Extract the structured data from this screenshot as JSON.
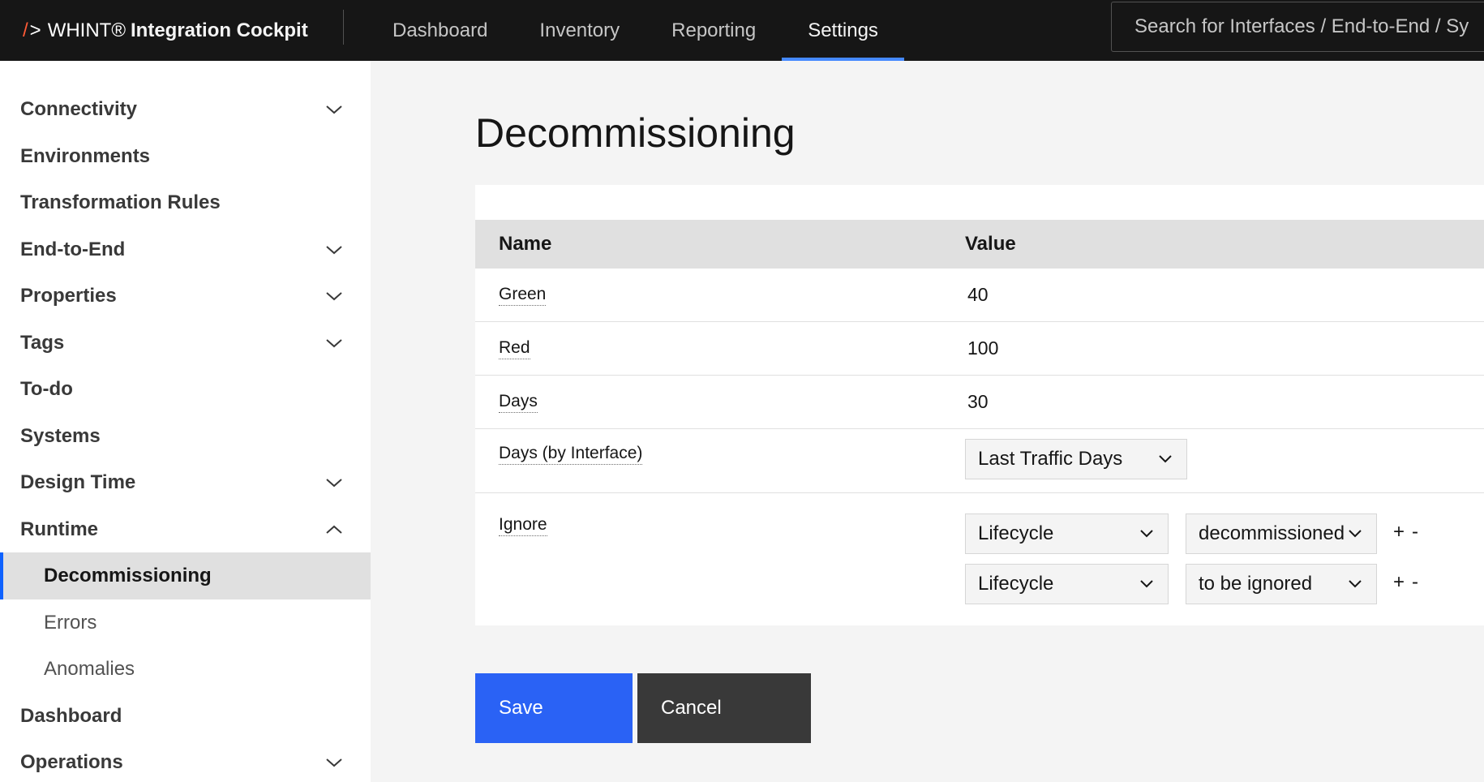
{
  "header": {
    "brand_slash": "/",
    "brand_gt": ">",
    "brand_name": "WHINT®",
    "brand_product": "Integration Cockpit",
    "nav": [
      {
        "label": "Dashboard"
      },
      {
        "label": "Inventory"
      },
      {
        "label": "Reporting"
      },
      {
        "label": "Settings",
        "active": true
      }
    ],
    "search_placeholder": "Search for Interfaces / End-to-End / Sy"
  },
  "sidebar": {
    "items": [
      {
        "label": "Connectivity",
        "chevron": "chevron-down-icon"
      },
      {
        "label": "Environments"
      },
      {
        "label": "Transformation Rules"
      },
      {
        "label": "End-to-End",
        "chevron": "chevron-down-icon"
      },
      {
        "label": "Properties",
        "chevron": "chevron-down-icon"
      },
      {
        "label": "Tags",
        "chevron": "chevron-down-icon"
      },
      {
        "label": "To-do"
      },
      {
        "label": "Systems"
      },
      {
        "label": "Design Time",
        "chevron": "chevron-down-icon"
      },
      {
        "label": "Runtime",
        "chevron": "chevron-up-icon"
      },
      {
        "label": "Decommissioning",
        "sub": true,
        "active": true
      },
      {
        "label": "Errors",
        "sub": true
      },
      {
        "label": "Anomalies",
        "sub": true
      },
      {
        "label": "Dashboard"
      },
      {
        "label": "Operations",
        "chevron": "chevron-down-icon"
      }
    ]
  },
  "main": {
    "title": "Decommissioning",
    "table": {
      "headers": {
        "name": "Name",
        "value": "Value"
      },
      "rows": [
        {
          "name": "Green",
          "value": "40"
        },
        {
          "name": "Red",
          "value": "100"
        },
        {
          "name": "Days",
          "value": "30"
        },
        {
          "name": "Days (by Interface)",
          "select": "Last Traffic Days"
        },
        {
          "name": "Ignore",
          "rules": [
            {
              "field": "Lifecycle",
              "value": "decommissioned",
              "plus": "+",
              "minus": "-"
            },
            {
              "field": "Lifecycle",
              "value": "to be ignored",
              "plus": "+",
              "minus": "-"
            }
          ]
        }
      ]
    },
    "buttons": {
      "save": "Save",
      "cancel": "Cancel"
    }
  },
  "colors": {
    "header_bg": "#161616",
    "accent": "#4589ff",
    "save_button": "#2a62f5",
    "cancel_button": "#393939",
    "brand_slash": "#ff5a36"
  }
}
